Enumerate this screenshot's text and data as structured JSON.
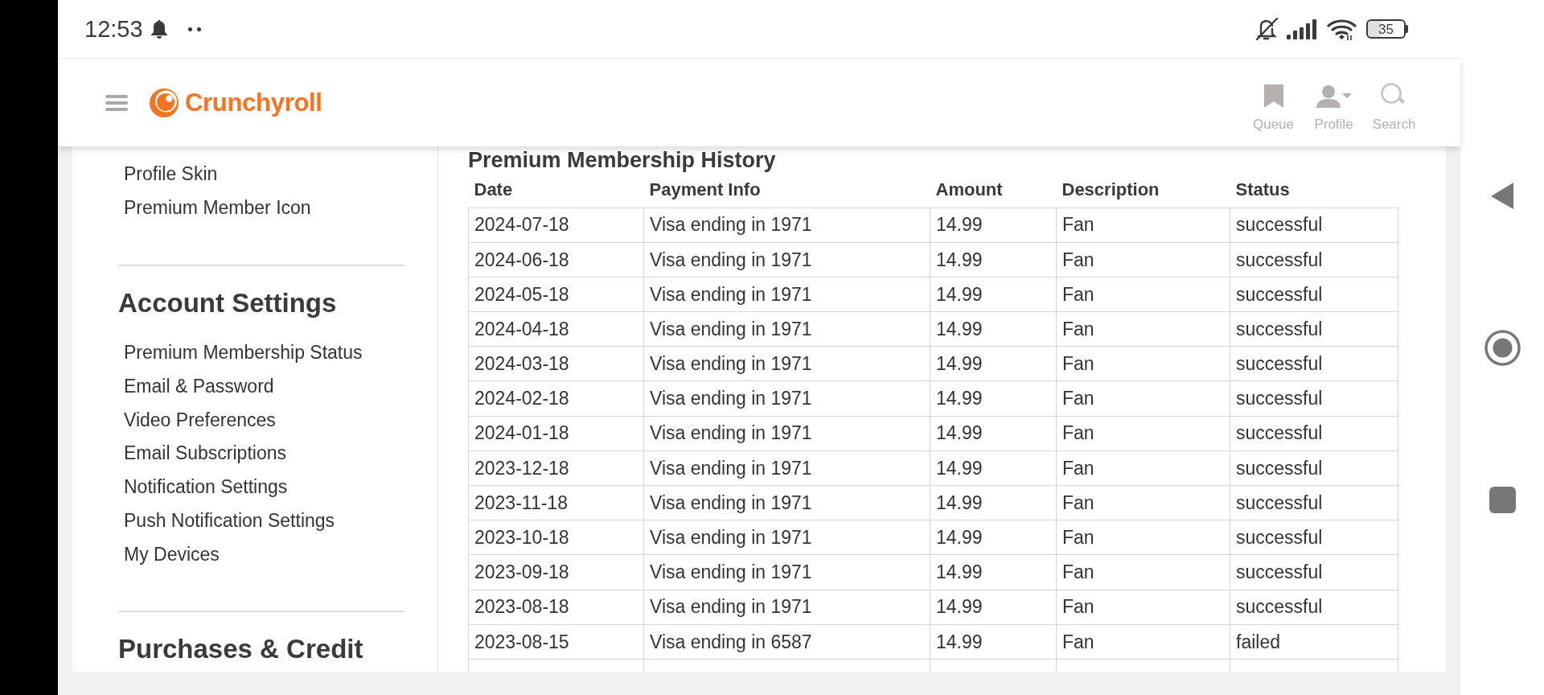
{
  "status_bar": {
    "time": "12:53",
    "battery": "35"
  },
  "header": {
    "logo": "Crunchyroll",
    "nav": [
      {
        "kind": "queue",
        "label": "Queue"
      },
      {
        "kind": "profile",
        "label": "Profile"
      },
      {
        "kind": "search",
        "label": "Search"
      }
    ]
  },
  "sidebar": {
    "sections": [
      {
        "items": [
          "Profile Skin",
          "Premium Member Icon"
        ]
      },
      {
        "title": "Account Settings",
        "items": [
          "Premium Membership Status",
          "Email & Password",
          "Video Preferences",
          "Email Subscriptions",
          "Notification Settings",
          "Push Notification Settings",
          "My Devices"
        ]
      },
      {
        "title": "Purchases & Credit"
      }
    ]
  },
  "main": {
    "title": "Premium Membership History",
    "table": {
      "columns": [
        "Date",
        "Payment Info",
        "Amount",
        "Description",
        "Status"
      ],
      "rows": [
        [
          "2024-07-18",
          "Visa ending in 1971",
          "14.99",
          "Fan",
          "successful"
        ],
        [
          "2024-06-18",
          "Visa ending in 1971",
          "14.99",
          "Fan",
          "successful"
        ],
        [
          "2024-05-18",
          "Visa ending in 1971",
          "14.99",
          "Fan",
          "successful"
        ],
        [
          "2024-04-18",
          "Visa ending in 1971",
          "14.99",
          "Fan",
          "successful"
        ],
        [
          "2024-03-18",
          "Visa ending in 1971",
          "14.99",
          "Fan",
          "successful"
        ],
        [
          "2024-02-18",
          "Visa ending in 1971",
          "14.99",
          "Fan",
          "successful"
        ],
        [
          "2024-01-18",
          "Visa ending in 1971",
          "14.99",
          "Fan",
          "successful"
        ],
        [
          "2023-12-18",
          "Visa ending in 1971",
          "14.99",
          "Fan",
          "successful"
        ],
        [
          "2023-11-18",
          "Visa ending in 1971",
          "14.99",
          "Fan",
          "successful"
        ],
        [
          "2023-10-18",
          "Visa ending in 1971",
          "14.99",
          "Fan",
          "successful"
        ],
        [
          "2023-09-18",
          "Visa ending in 1971",
          "14.99",
          "Fan",
          "successful"
        ],
        [
          "2023-08-18",
          "Visa ending in 1971",
          "14.99",
          "Fan",
          "successful"
        ],
        [
          "2023-08-15",
          "Visa ending in 6587",
          "14.99",
          "Fan",
          "failed"
        ]
      ]
    }
  }
}
